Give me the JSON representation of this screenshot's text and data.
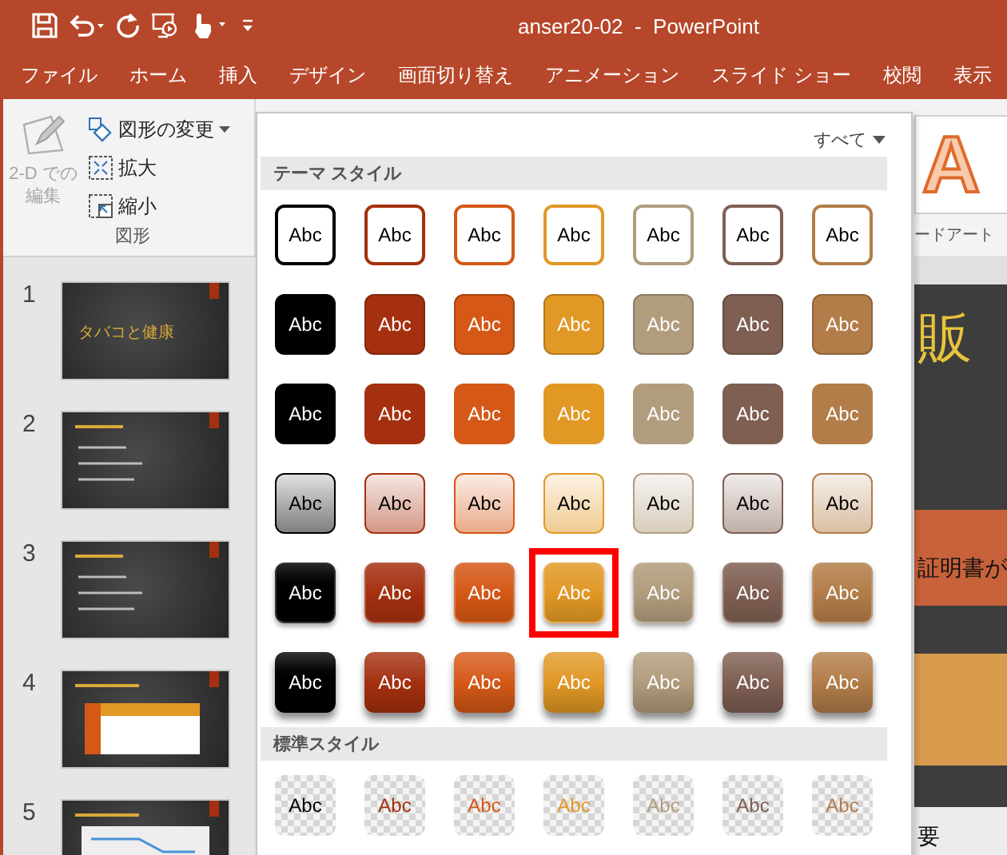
{
  "window": {
    "title": "anser20-02  -  PowerPoint"
  },
  "tabs": [
    {
      "label": "ファイル",
      "selected": false
    },
    {
      "label": "ホーム",
      "selected": false
    },
    {
      "label": "挿入",
      "selected": false
    },
    {
      "label": "デザイン",
      "selected": false
    },
    {
      "label": "画面切り替え",
      "selected": false
    },
    {
      "label": "アニメーション",
      "selected": false
    },
    {
      "label": "スライド ショー",
      "selected": false
    },
    {
      "label": "校閲",
      "selected": false
    },
    {
      "label": "表示",
      "selected": false
    }
  ],
  "ribbon": {
    "group_label": "図形",
    "large_button": {
      "label_lines": [
        "2-D での",
        "編集"
      ],
      "disabled": true
    },
    "buttons": [
      {
        "kind": "change",
        "label": "図形の変更",
        "dropdown": true
      },
      {
        "kind": "enlarge",
        "label": "拡大",
        "dropdown": false
      },
      {
        "kind": "shrink",
        "label": "縮小",
        "dropdown": false
      }
    ]
  },
  "slides": [
    {
      "number": "1",
      "kind": "title",
      "title": "タバコと健康"
    },
    {
      "number": "2",
      "kind": "bullets"
    },
    {
      "number": "3",
      "kind": "bullets"
    },
    {
      "number": "4",
      "kind": "table"
    },
    {
      "number": "5",
      "kind": "chart"
    }
  ],
  "gallery": {
    "filter": "すべて",
    "sections": [
      {
        "title": "テーマ スタイル",
        "rows": [
          {
            "kind": "outline",
            "items": [
              {
                "label": "Abc",
                "color": "#000000",
                "selected": false
              },
              {
                "label": "Abc",
                "color": "#a5300f",
                "selected": false
              },
              {
                "label": "Abc",
                "color": "#d55816",
                "selected": false
              },
              {
                "label": "Abc",
                "color": "#e19825",
                "selected": false
              },
              {
                "label": "Abc",
                "color": "#b19c7d",
                "selected": false
              },
              {
                "label": "Abc",
                "color": "#7f5f52",
                "selected": false
              },
              {
                "label": "Abc",
                "color": "#b27d49",
                "selected": false
              }
            ]
          },
          {
            "kind": "solid",
            "items": [
              {
                "label": "Abc",
                "color": "#000000",
                "selected": false
              },
              {
                "label": "Abc",
                "color": "#a5300f",
                "selected": false
              },
              {
                "label": "Abc",
                "color": "#d55816",
                "selected": false
              },
              {
                "label": "Abc",
                "color": "#e19825",
                "selected": false
              },
              {
                "label": "Abc",
                "color": "#b19c7d",
                "selected": false
              },
              {
                "label": "Abc",
                "color": "#7f5f52",
                "selected": false
              },
              {
                "label": "Abc",
                "color": "#b27d49",
                "selected": false
              }
            ]
          },
          {
            "kind": "plain",
            "items": [
              {
                "label": "Abc",
                "color": "#000000",
                "selected": false
              },
              {
                "label": "Abc",
                "color": "#a5300f",
                "selected": false
              },
              {
                "label": "Abc",
                "color": "#d55816",
                "selected": false
              },
              {
                "label": "Abc",
                "color": "#e19825",
                "selected": false
              },
              {
                "label": "Abc",
                "color": "#b19c7d",
                "selected": false
              },
              {
                "label": "Abc",
                "color": "#7f5f52",
                "selected": false
              },
              {
                "label": "Abc",
                "color": "#b27d49",
                "selected": false
              }
            ]
          },
          {
            "kind": "light",
            "items": [
              {
                "label": "Abc",
                "color": "#000000",
                "selected": false
              },
              {
                "label": "Abc",
                "color": "#a5300f",
                "selected": false
              },
              {
                "label": "Abc",
                "color": "#d55816",
                "selected": false
              },
              {
                "label": "Abc",
                "color": "#e19825",
                "selected": false
              },
              {
                "label": "Abc",
                "color": "#b19c7d",
                "selected": false
              },
              {
                "label": "Abc",
                "color": "#7f5f52",
                "selected": false
              },
              {
                "label": "Abc",
                "color": "#b27d49",
                "selected": false
              }
            ]
          },
          {
            "kind": "gradient",
            "items": [
              {
                "label": "Abc",
                "color": "#000000",
                "selected": false
              },
              {
                "label": "Abc",
                "color": "#a5300f",
                "selected": false
              },
              {
                "label": "Abc",
                "color": "#d55816",
                "selected": false
              },
              {
                "label": "Abc",
                "color": "#e19825",
                "selected": true
              },
              {
                "label": "Abc",
                "color": "#b19c7d",
                "selected": false
              },
              {
                "label": "Abc",
                "color": "#7f5f52",
                "selected": false
              },
              {
                "label": "Abc",
                "color": "#b27d49",
                "selected": false
              }
            ]
          },
          {
            "kind": "shadow",
            "items": [
              {
                "label": "Abc",
                "color": "#000000",
                "selected": false
              },
              {
                "label": "Abc",
                "color": "#a5300f",
                "selected": false
              },
              {
                "label": "Abc",
                "color": "#d55816",
                "selected": false
              },
              {
                "label": "Abc",
                "color": "#e19825",
                "selected": false
              },
              {
                "label": "Abc",
                "color": "#b19c7d",
                "selected": false
              },
              {
                "label": "Abc",
                "color": "#7f5f52",
                "selected": false
              },
              {
                "label": "Abc",
                "color": "#b27d49",
                "selected": false
              }
            ]
          }
        ]
      },
      {
        "title": "標準スタイル",
        "rows": [
          {
            "kind": "transparent",
            "items": [
              {
                "label": "Abc",
                "color": "#000000",
                "selected": false
              },
              {
                "label": "Abc",
                "color": "#a5300f",
                "selected": false
              },
              {
                "label": "Abc",
                "color": "#d55816",
                "selected": false
              },
              {
                "label": "Abc",
                "color": "#e19825",
                "selected": false
              },
              {
                "label": "Abc",
                "color": "#b19c7d",
                "selected": false
              },
              {
                "label": "Abc",
                "color": "#7f5f52",
                "selected": false
              },
              {
                "label": "Abc",
                "color": "#b27d49",
                "selected": false
              }
            ]
          }
        ]
      }
    ]
  },
  "slide_view": {
    "wordart_letter": "A",
    "ribbon_text": "ードアート",
    "heading": "販",
    "bar_text": "証明書が",
    "footer_text": "要"
  }
}
